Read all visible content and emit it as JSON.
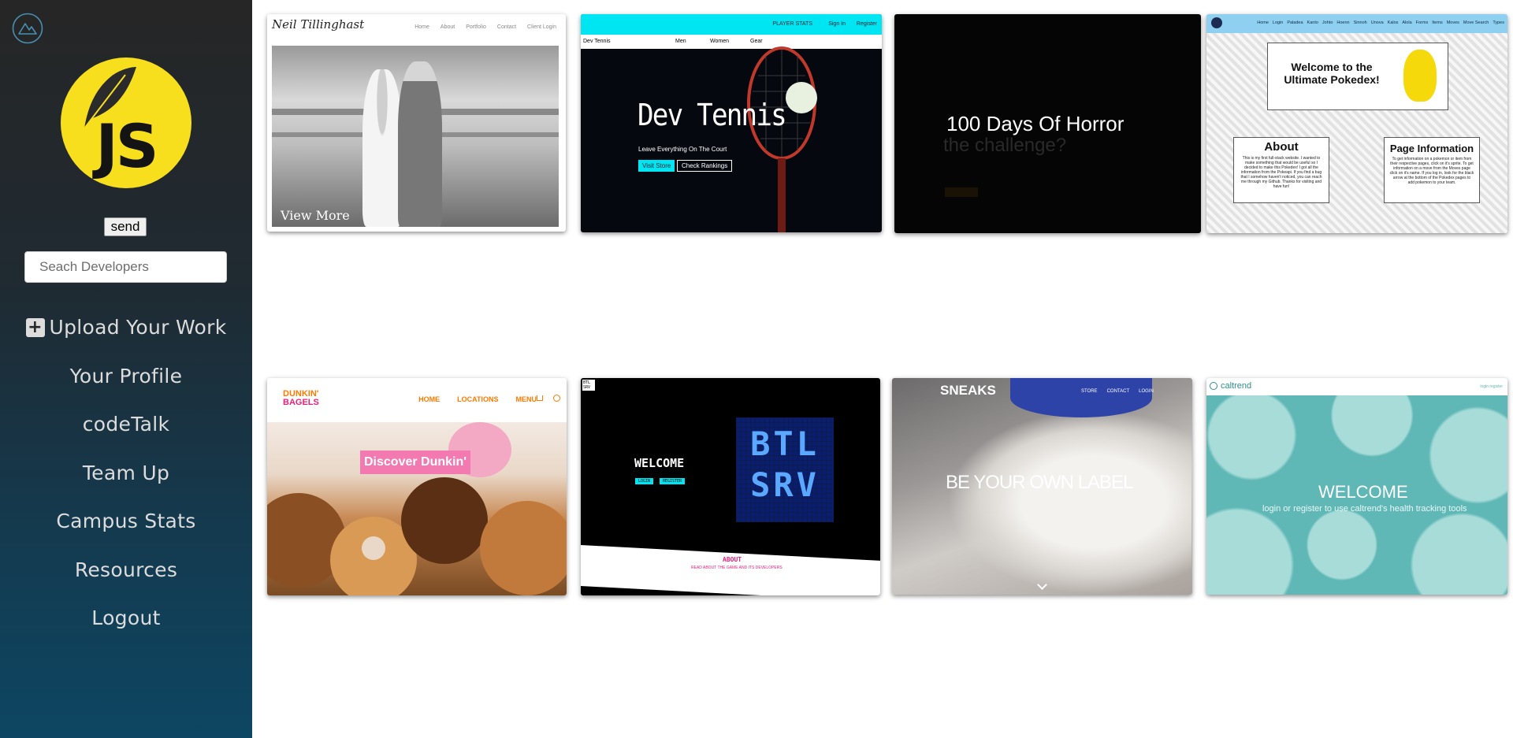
{
  "sidebar": {
    "logo_icon": "mountain-circle-icon",
    "badge_text": "JS",
    "send_label": "send",
    "search_placeholder": "Seach Developers",
    "nav": [
      {
        "label": "Upload Your Work",
        "icon": "plus-square-icon"
      },
      {
        "label": "Your Profile"
      },
      {
        "label": "codeTalk"
      },
      {
        "label": "Team Up"
      },
      {
        "label": "Campus Stats"
      },
      {
        "label": "Resources"
      },
      {
        "label": "Logout"
      }
    ]
  },
  "projects": {
    "p1": {
      "brand": "Neil Tillinghast",
      "nav": [
        "Home",
        "About",
        "Portfolio",
        "Contact",
        "Client Login"
      ],
      "cta": "View More"
    },
    "p2": {
      "top_nav": [
        "Men",
        "Women",
        "Gear"
      ],
      "top_right": [
        "PLAYER STATS",
        "Sign In",
        "Register"
      ],
      "brand_small": "Dev Tennis",
      "title": "Dev Tennis",
      "subtitle": "Leave Everything On The Court",
      "btn1": "Visit Store",
      "btn2": "Check Rankings"
    },
    "p3": {
      "title": "100 Days Of Horror",
      "faded": "the challenge?"
    },
    "p4": {
      "nav": [
        "Home",
        "Login",
        "Paladea",
        "Kanto",
        "Johto",
        "Hoenn",
        "Sinnoh",
        "Unova",
        "Kalos",
        "Alola",
        "Forms",
        "Items",
        "Moves",
        "Move Search",
        "Types"
      ],
      "welcome": "Welcome to the Ultimate Pokedex!",
      "about_title": "About",
      "about_text": "This is my first full-stack website. I wanted to make something that would be useful so I decided to make this Pokedex! I got all the information from the Pokeapi. If you find a bug that I somehow haven't noticed, you can reach me through my Github. Thanks for visiting and have fun!",
      "info_title": "Page Information",
      "info_text": "To get information on a pokemon or item from their respective pages, click on it's sprite. To get information on a move from the Moves page click on it's name. If you log in, look for the black arrow at the bottom of the Pokedex pages to add pokemon to your team."
    },
    "p5": {
      "brand_line1": "DUNKIN'",
      "brand_line2": "BAGELS",
      "nav": [
        "HOME",
        "LOCATIONS",
        "MENU"
      ],
      "banner": "Discover Dunkin'"
    },
    "p6": {
      "logo": "BTL SRV",
      "welcome": "WELCOME",
      "btn1": "LOGIN",
      "btn2": "REGISTER",
      "about": "ABOUT",
      "about_sub": "READ ABOUT THE GAME AND ITS DEVELOPERS",
      "pixel_text": "BTL SRV"
    },
    "p7": {
      "brand": "SNEAKS",
      "nav": [
        "STORE",
        "CONTACT",
        "LOGIN"
      ],
      "headline": "BE YOUR OWN LABEL"
    },
    "p8": {
      "brand": "caltrend",
      "nav_right": "login register",
      "title": "WELCOME",
      "sub": "login or register to use caltrend's health tracking tools"
    }
  },
  "colors": {
    "accent_cyan": "#00e5f2",
    "dunkin_orange": "#ff7a00",
    "dunkin_pink": "#e8217a",
    "teal": "#5fb8b6"
  }
}
